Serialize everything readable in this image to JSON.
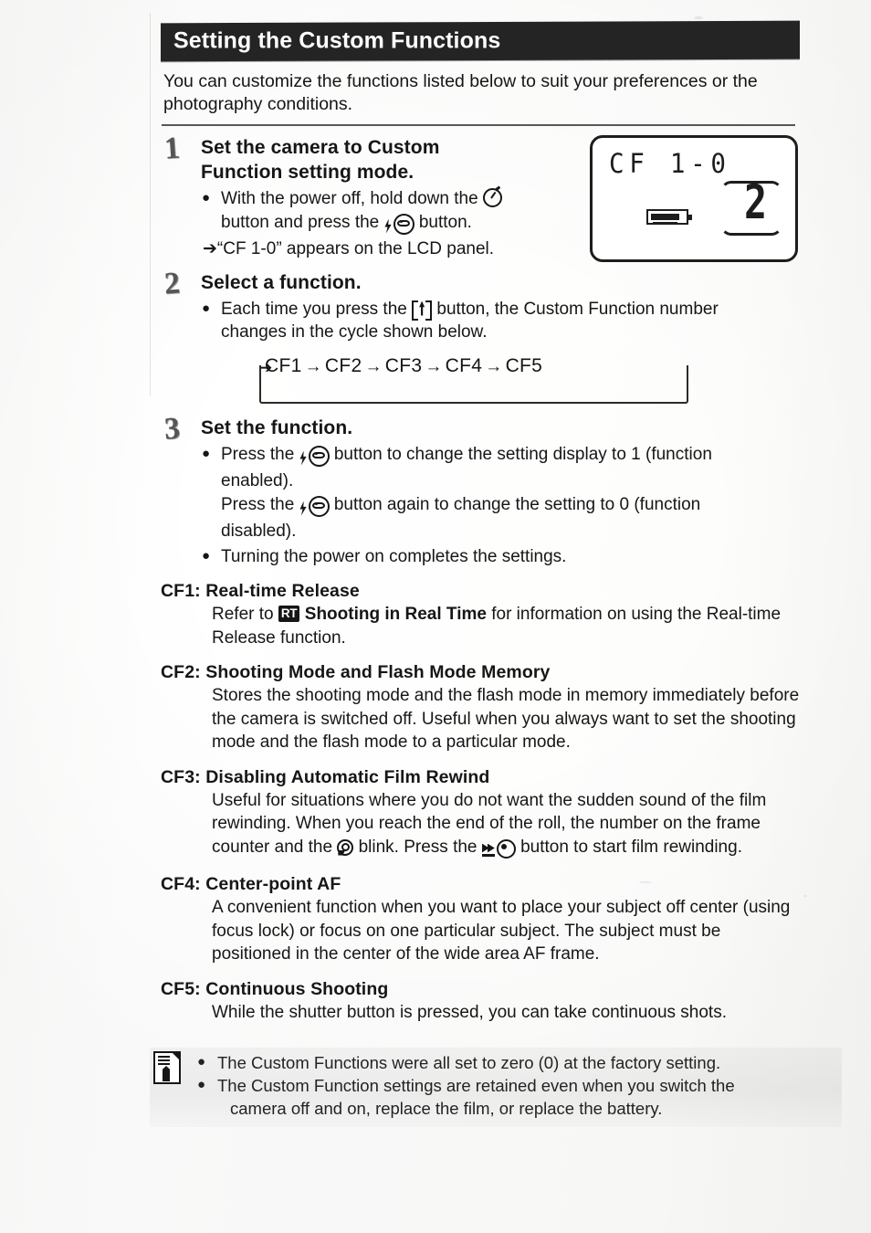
{
  "header": {
    "title": "Setting the Custom Functions"
  },
  "intro": "You can customize the functions listed below to suit your preferences or the photography conditions.",
  "steps": [
    {
      "number": "1",
      "title_line1": "Set the camera to Custom",
      "title_line2": "Function setting mode.",
      "bullet1_a": "With the power off, hold down the",
      "bullet1_icon": "self-timer-icon",
      "bullet1_b": "button and press the",
      "bullet1_icon2": "flash-redeye-icon",
      "bullet1_c": "button.",
      "arrow_note": "“CF 1-0” appears on the LCD panel."
    },
    {
      "number": "2",
      "title": "Select a function.",
      "bullet_a": "Each time you press the",
      "bullet_icon": "drive-mode-button-icon",
      "bullet_b": "button, the Custom Function number",
      "bullet_c": "changes in the cycle shown below."
    },
    {
      "number": "3",
      "title": "Set the function.",
      "bullet1_a": "Press the",
      "bullet1_icon": "flash-redeye-icon",
      "bullet1_b": "button to change the setting display to 1 (function",
      "bullet1_c": "enabled).",
      "bullet1_d": "Press the",
      "bullet1_e": "button again to change the setting to 0 (function",
      "bullet1_f": "disabled).",
      "bullet2": "Turning the power on completes the settings."
    }
  ],
  "lcd": {
    "top_text": "CF  1-0",
    "counter": "2",
    "battery_icon": "battery-full-icon"
  },
  "cycle": {
    "items": [
      "CF1",
      "CF2",
      "CF3",
      "CF4",
      "CF5"
    ],
    "arrow": "→"
  },
  "functions": [
    {
      "head": "CF1: Real-time Release",
      "body_a": "Refer to",
      "badge": "RT",
      "body_b": "Shooting in Real Time",
      "body_c": "for information on using the Real-time Release function."
    },
    {
      "head": "CF2: Shooting Mode and Flash Mode Memory",
      "body": "Stores the shooting mode and the flash mode in memory immediately before the camera is switched off. Useful when you always want to set the shooting mode and the flash mode to a particular mode."
    },
    {
      "head": "CF3: Disabling Automatic Film Rewind",
      "body_a": "Useful for situations where you do not want the sudden sound of the film rewinding. When you reach the end of the roll, the number on the frame counter and the",
      "icon1": "film-cartridge-icon",
      "body_b": "blink. Press the",
      "icon2": "rewind-button-icon",
      "body_c": "button to start film rewinding."
    },
    {
      "head": "CF4: Center-point AF",
      "body_a": "A convenient function when you want to place your subject off center (using focus lock) or focus on one particular subject.",
      "body_b": "The subject must be positioned in the center of the wide area AF frame."
    },
    {
      "head": "CF5: Continuous Shooting",
      "body": "While the shutter button is pressed, you can take continuous shots."
    }
  ],
  "note": {
    "icon": "memo-note-icon",
    "line1": "The Custom Functions were all set to zero (0) at the factory setting.",
    "line2_a": "The Custom Function settings are retained even when you switch the",
    "line2_b": "camera off and on, replace the film, or replace the battery."
  }
}
